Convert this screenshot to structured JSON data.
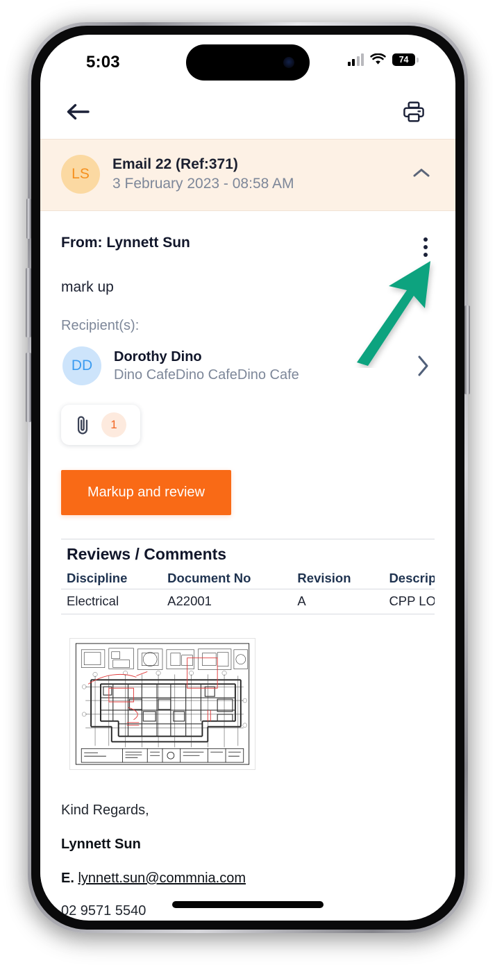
{
  "status_bar": {
    "time": "5:03",
    "battery_level": "74",
    "signal_icon": "cellular-signal-icon",
    "wifi_icon": "wifi-icon",
    "battery_icon": "battery-icon"
  },
  "nav_bar": {
    "back_icon": "back-arrow-icon",
    "print_icon": "printer-icon"
  },
  "email_header": {
    "avatar_initials": "LS",
    "title_prefix": "Email",
    "title_rest": " 22 (Ref:371)",
    "date": "3 February 2023 - 08:58 AM",
    "collapse_icon": "chevron-up-icon",
    "background_color": "#FDF1E5",
    "avatar_bg": "#FBD9A2",
    "avatar_fg": "#F5901E"
  },
  "message": {
    "from": "From: Lynnett Sun",
    "subject": "mark up",
    "recipients_label": "Recipient(s):",
    "more_menu_icon": "kebab-menu-icon"
  },
  "recipient": {
    "avatar_initials": "DD",
    "name": "Dorothy Dino",
    "organisation": "Dino CafeDino CafeDino Cafe",
    "chevron_icon": "chevron-right-icon",
    "avatar_bg": "#CDE4FB",
    "avatar_fg": "#3B9BF0"
  },
  "attachments": {
    "icon": "paperclip-icon",
    "count": "1",
    "badge_bg": "#FDEADE",
    "badge_fg": "#F26522"
  },
  "actions": {
    "markup_label": "Markup and review",
    "markup_color": "#F96A16"
  },
  "reviews_table": {
    "caption": "Reviews / Comments",
    "columns": [
      "Discipline",
      "Document No",
      "Revision",
      "Description"
    ],
    "rows": [
      [
        "Electrical",
        "A22001",
        "A",
        "CPP LOWER GRO"
      ]
    ]
  },
  "attachment_preview": {
    "name": "floor-plan-drawing",
    "description": "Architectural CAD floor plan with red markup annotations"
  },
  "signature": {
    "closing": "Kind Regards,",
    "name": "Lynnett Sun",
    "email_prefix": "E.",
    "email": "lynnett.sun@commnia.com",
    "phone": "02 9571 5540"
  },
  "annotation": {
    "arrow_icon": "green-pointer-arrow",
    "color": "#10A37F",
    "points_at": "kebab-menu-icon"
  }
}
